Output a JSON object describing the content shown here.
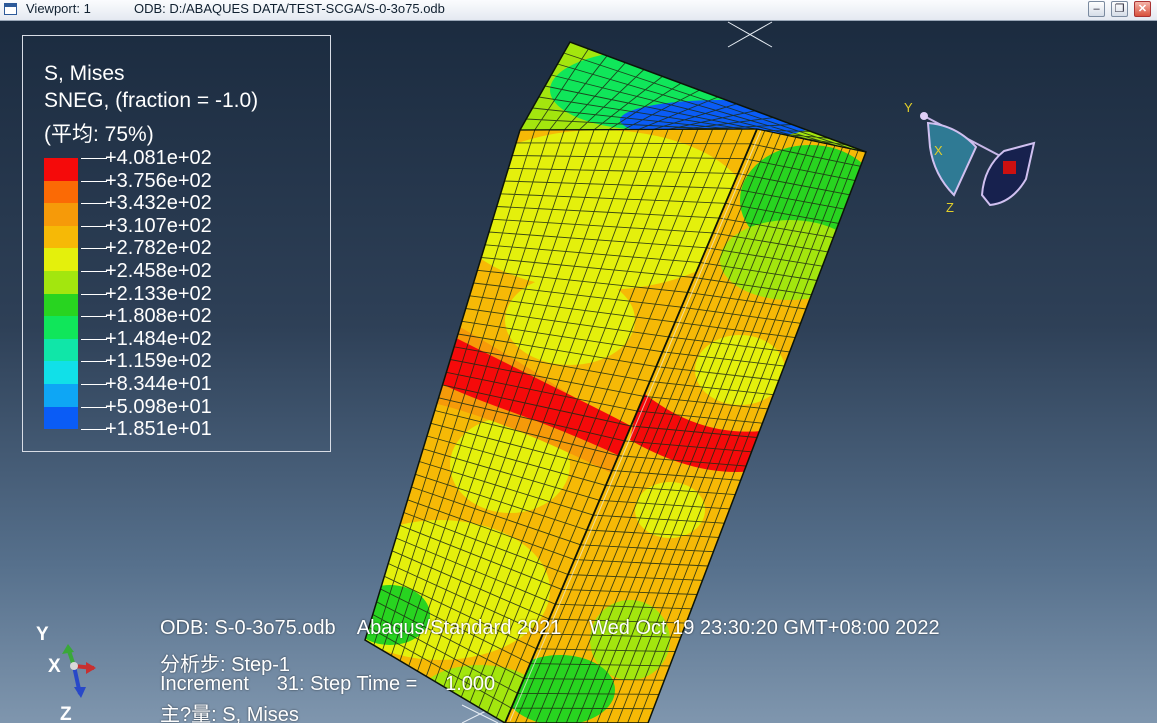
{
  "titlebar": {
    "viewport_label": "Viewport: 1",
    "odb_path": "ODB: D:/ABAQUES DATA/TEST-SCGA/S-0-3o75.odb",
    "minimize_icon": "minimize-icon",
    "restore_icon": "restore-icon",
    "close_icon": "close-icon"
  },
  "legend": {
    "title_line1": "S, Mises",
    "title_line2": "SNEG, (fraction = -1.0)",
    "title_line3": "(平均: 75%)",
    "levels": [
      {
        "value": "+4.081e+02",
        "color": "#f50a0a"
      },
      {
        "value": "+3.756e+02",
        "color": "#fb6a05"
      },
      {
        "value": "+3.432e+02",
        "color": "#f69a09"
      },
      {
        "value": "+3.107e+02",
        "color": "#f6b906"
      },
      {
        "value": "+2.782e+02",
        "color": "#e4f00c"
      },
      {
        "value": "+2.458e+02",
        "color": "#a3e60e"
      },
      {
        "value": "+2.133e+02",
        "color": "#28d420"
      },
      {
        "value": "+1.808e+02",
        "color": "#10e65a"
      },
      {
        "value": "+1.484e+02",
        "color": "#10e6a8"
      },
      {
        "value": "+1.159e+02",
        "color": "#11e0e8"
      },
      {
        "value": "+8.344e+01",
        "color": "#0ea6f5"
      },
      {
        "value": "+5.098e+01",
        "color": "#0a5cf6"
      },
      {
        "value": "+1.851e+01",
        "color": "#0b14f7"
      }
    ]
  },
  "info": {
    "line1": "ODB: S-0-3o75.odb    Abaqus/Standard 2021     Wed Oct 19 23:30:20 GMT+08:00 2022",
    "line2": "分析步: Step-1",
    "line3": "Increment     31: Step Time =     1.000",
    "line4": "主?量: S, Mises"
  },
  "triad": {
    "y": "Y",
    "x": "X",
    "z": "Z"
  },
  "view_cube": {
    "y": "Y",
    "x": "X",
    "z": "Z"
  },
  "colors": {
    "background_top": "#1a2a3e",
    "background_bottom": "#7f96ae",
    "mesh_line": "#1c2a14"
  }
}
